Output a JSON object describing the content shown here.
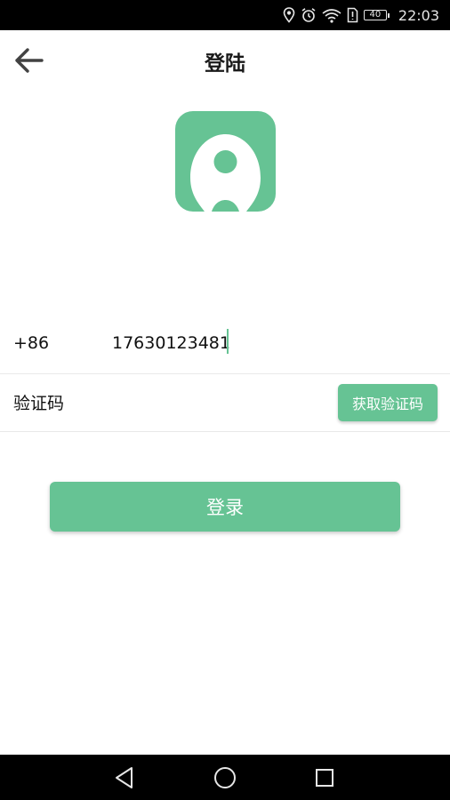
{
  "status_bar": {
    "battery_level": "40",
    "time": "22:03",
    "icons": [
      "location-icon",
      "alarm-icon",
      "wifi-icon",
      "sim-icon",
      "battery-icon"
    ]
  },
  "header": {
    "title": "登陆",
    "back_icon": "arrow-left-icon"
  },
  "logo": {
    "icon": "location-pin-logo",
    "color": "#66c394"
  },
  "form": {
    "country_code": "+86",
    "phone_value": "17630123481",
    "code_placeholder": "验证码",
    "get_code_label": "获取验证码"
  },
  "login_label": "登录",
  "nav_bar": {
    "icons": [
      "nav-back-icon",
      "nav-home-icon",
      "nav-recents-icon"
    ]
  },
  "colors": {
    "accent": "#66c394",
    "divider": "#e9e9e9",
    "bar_bg": "#000000"
  }
}
